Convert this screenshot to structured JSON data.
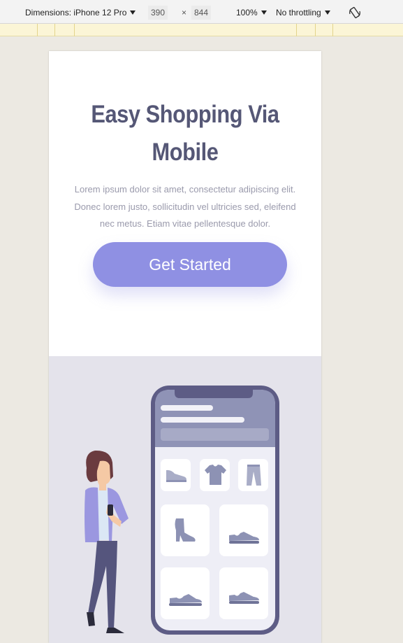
{
  "devtools": {
    "dimensions_label": "Dimensions: iPhone 12 Pro",
    "width": "390",
    "times": "×",
    "height": "844",
    "zoom": "100%",
    "throttling": "No throttling",
    "rotate_icon": "rotate-device-icon"
  },
  "hero": {
    "title": "Easy Shopping Via Mobile",
    "description": "Lorem ipsum dolor sit amet, consectetur adipiscing elit. Donec lorem justo, sollicitudin vel ultricies sed, eleifend nec metus. Etiam vitae pellentesque dolor.",
    "cta_label": "Get Started"
  },
  "illustration": {
    "icons": [
      "flat-shoe-icon",
      "tshirt-icon",
      "pants-icon",
      "boot-icon",
      "sneaker-icon",
      "sneaker-icon",
      "sneaker-icon"
    ],
    "colors": {
      "phone_frame": "#5d5c85",
      "phone_header": "#8f93b6",
      "tile_icon": "#8d92b4",
      "jacket": "#9b97e0",
      "hair": "#6a3b3f"
    }
  }
}
